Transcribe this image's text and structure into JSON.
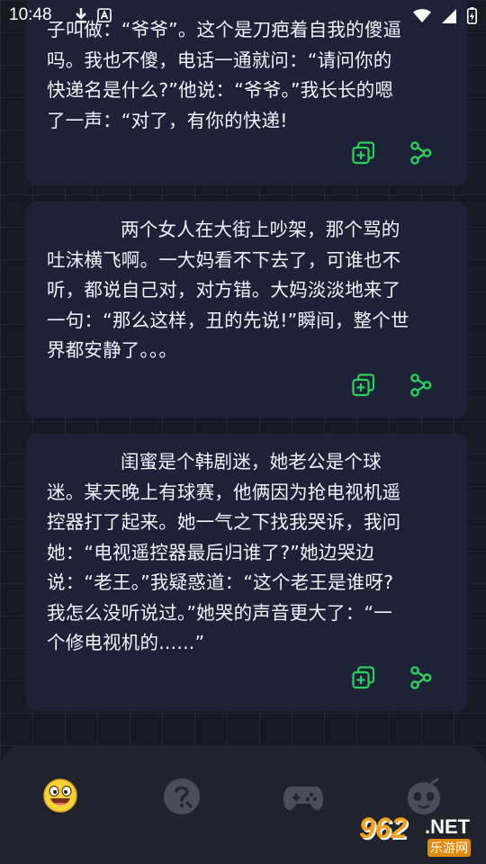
{
  "status_bar": {
    "time": "10:48"
  },
  "cards": [
    {
      "lines": [
        "子叫做：“爷爷”。这个是刀疤着自我的傻逼",
        "吗。我也不傻，电话一通就问：“请问你的",
        "快递名是什么?”他说：“爷爷。”我长长的嗯",
        "了一声：“对了，有你的快递!"
      ]
    },
    {
      "lines": [
        "两个女人在大街上吵架，那个骂的",
        "吐沫横飞啊。一大妈看不下去了，可谁也不",
        "听，都说自己对，对方错。大妈淡淡地来了",
        "一句：“那么这样，丑的先说!”瞬间，整个世",
        "界都安静了。。。"
      ]
    },
    {
      "lines": [
        "闺蜜是个韩剧迷，她老公是个球",
        "迷。某天晚上有球赛，他俩因为抢电视机遥",
        "控器打了起来。她一气之下找我哭诉，我问",
        "她：“电视遥控器最后归谁了?”她边哭边",
        "说：“老王。”我疑惑道：“这个老王是谁呀?",
        "我怎么没听说过。”她哭的声音更大了：“一",
        "个修电视机的......”"
      ]
    }
  ],
  "actions": {
    "copy_icon": "copy-add-icon",
    "share_icon": "share-icon"
  },
  "bottom_nav": {
    "tabs": [
      {
        "icon": "laughing-face-icon",
        "active": true
      },
      {
        "icon": "riddle-question-icon",
        "active": false
      },
      {
        "icon": "gamepad-icon",
        "active": false
      },
      {
        "icon": "alien-face-icon",
        "active": false
      }
    ]
  },
  "watermark": {
    "number": "962",
    "domain": ".NET",
    "subtitle": "乐游网"
  },
  "colors": {
    "accent": "#2fd05a",
    "card": "#1d2239",
    "background": "#161a22",
    "nav": "#20232b"
  }
}
